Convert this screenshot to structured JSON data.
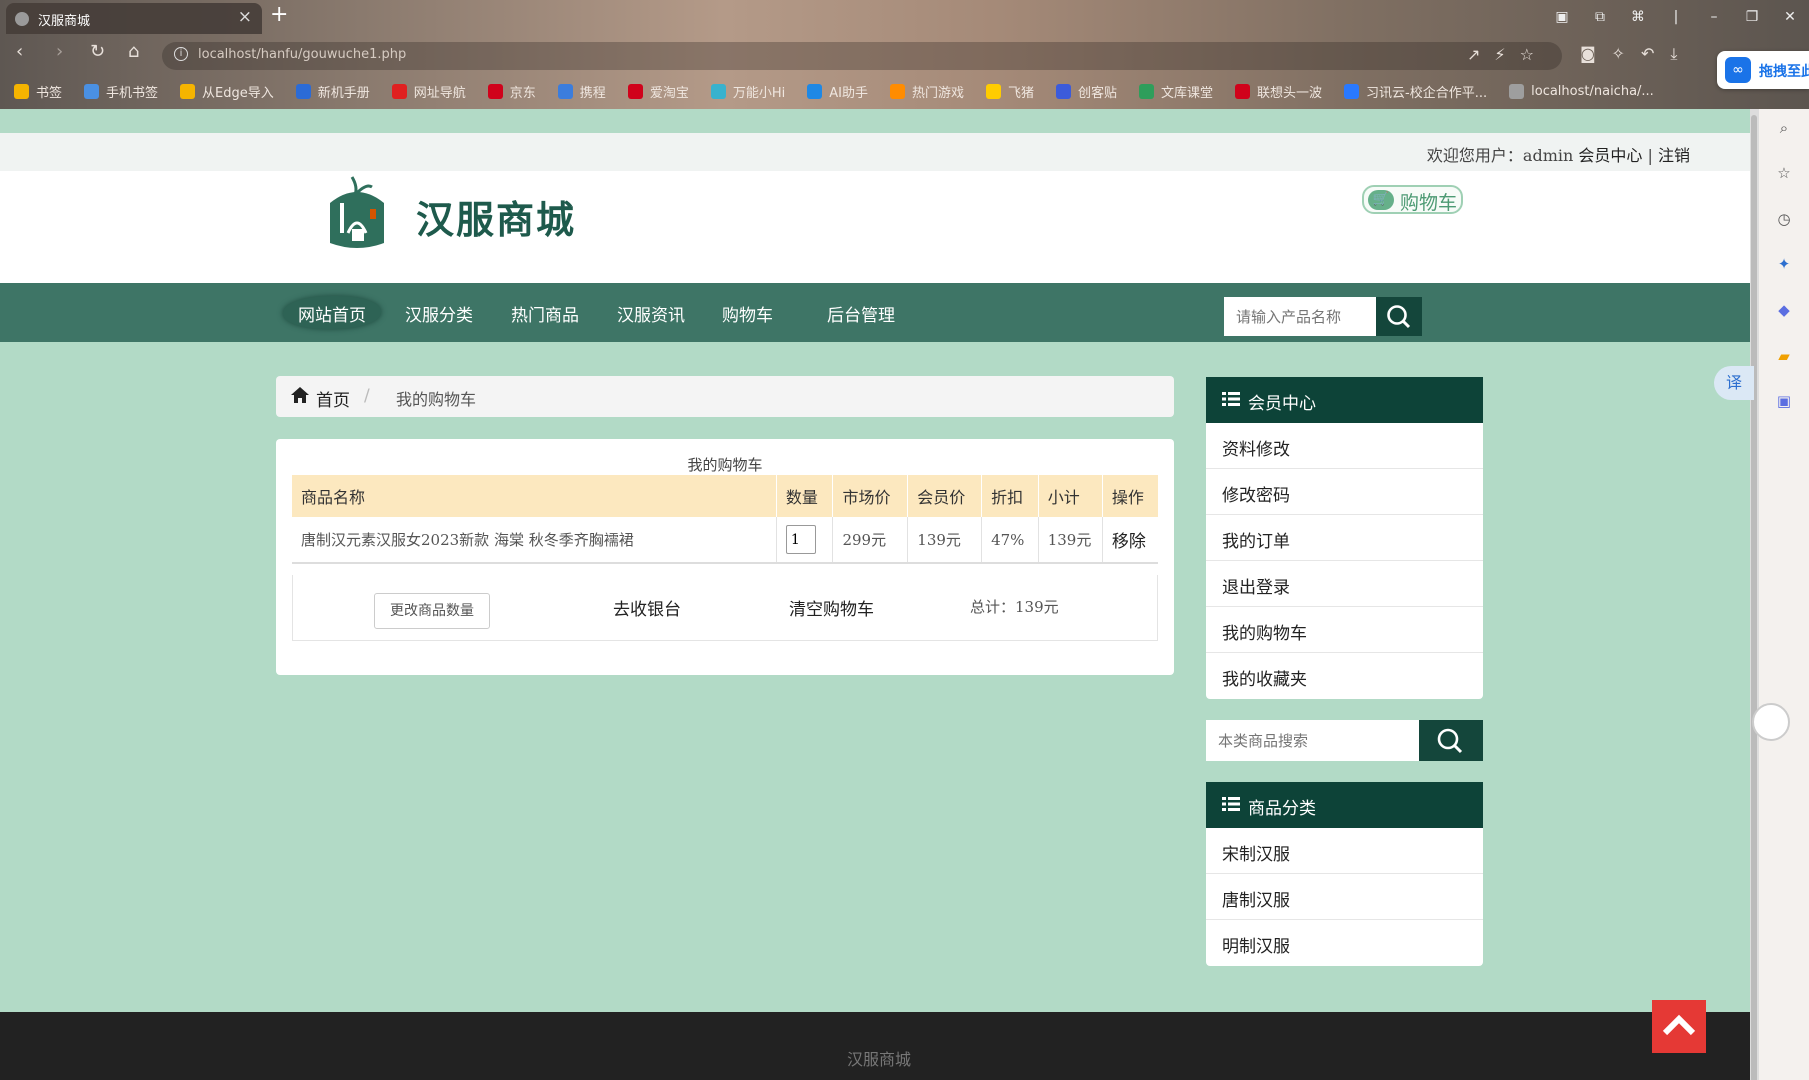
{
  "browser": {
    "tab_title": "汉服商城",
    "url": "localhost/hanfu/gouwuche1.php",
    "drag_button": "拖拽至此",
    "bookmarks": [
      "书签",
      "手机书签",
      "从Edge导入",
      "新机手册",
      "网址导航",
      "京东",
      "携程",
      "爱淘宝",
      "万能小Hi",
      "AI助手",
      "热门游戏",
      "飞猪",
      "创客贴",
      "文库课堂",
      "联想头一波",
      "习讯云-校企合作平...",
      "localhost/naicha/..."
    ],
    "bookmark_colors": [
      "#f5b400",
      "#4a90e2",
      "#f5b400",
      "#2b6bd6",
      "#e02020",
      "#d0021b",
      "#3b7ddd",
      "#d0021b",
      "#38b2ce",
      "#1e88e5",
      "#ff8c00",
      "#ffcc00",
      "#3b5bdb",
      "#2e9e5b",
      "#d0021b",
      "#2979ff",
      "#9e9e9e"
    ],
    "translate_label": "译"
  },
  "site": {
    "welcome_prefix": "欢迎您用户：",
    "username": "admin",
    "member_center_link": "会员中心",
    "separator": "|",
    "logout_link": "注销",
    "name": "汉服商城",
    "cart_button": "购物车",
    "nav": [
      "网站首页",
      "汉服分类",
      "热门商品",
      "汉服资讯",
      "购物车",
      "后台管理"
    ],
    "search_placeholder": "请输入产品名称",
    "theme_color": "#3e7566",
    "dark_color": "#0d4338"
  },
  "breadcrumb": {
    "home": "首页",
    "sep": "/",
    "current": "我的购物车"
  },
  "cart": {
    "title": "我的购物车",
    "headers": [
      "商品名称",
      "数量",
      "市场价",
      "会员价",
      "折扣",
      "小计",
      "操作"
    ],
    "rows": [
      {
        "name": "唐制汉元素汉服女2023新款 海棠 秋冬季齐胸襦裙",
        "qty": "1",
        "market_price": "299元",
        "member_price": "139元",
        "discount": "47%",
        "subtotal": "139元",
        "action": "移除"
      }
    ],
    "update_button": "更改商品数量",
    "checkout": "去收银台",
    "clear": "清空购物车",
    "total": "总计：139元"
  },
  "sidebar": {
    "member_title": "会员中心",
    "member_items": [
      "资料修改",
      "修改密码",
      "我的订单",
      "退出登录",
      "我的购物车",
      "我的收藏夹"
    ],
    "search_placeholder": "本类商品搜索",
    "category_title": "商品分类",
    "category_items": [
      "宋制汉服",
      "唐制汉服",
      "明制汉服"
    ]
  },
  "footer": {
    "text": "汉服商城"
  }
}
